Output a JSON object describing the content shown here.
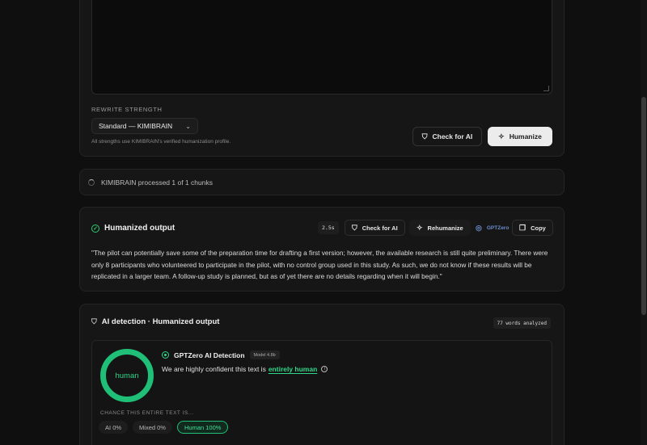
{
  "rewrite": {
    "label": "REWRITE STRENGTH",
    "selected": "Standard — KIMIBRAIN",
    "hint": "All strengths use KIMIBRAIN's verified humanization profile.",
    "check_label": "Check for AI",
    "humanize_label": "Humanize"
  },
  "status": {
    "text": "KIMIBRAIN processed 1 of 1 chunks"
  },
  "output": {
    "title": "Humanized output",
    "time": "2.5s",
    "check_label": "Check for AI",
    "rehumanize_label": "Rehumanize",
    "gptzero_label": "GPTZero",
    "copy_label": "Copy",
    "text": "\"The pilot can potentially save some of the preparation time for drafting a first version; however, the available research is still quite preliminary. There were only 8 participants who volunteered to participate in the pilot, with no control group used in this study. As such, we do not know if these results will be replicated in a larger team. A follow-up study is planned, but as of yet there are no details regarding when it will begin.\""
  },
  "detection": {
    "title": "AI detection · Humanized output",
    "words": "77 words analyzed",
    "ring_label": "human",
    "ring_color": "#1fbf78",
    "provider": "GPTZero AI Detection",
    "model": "Model 4.8b",
    "verdict_prefix": "We are highly confident this text is",
    "verdict_highlight": "entirely human",
    "chance_label": "CHANCE THIS ENTIRE TEXT IS...",
    "pills": [
      {
        "label": "AI",
        "value": "0%"
      },
      {
        "label": "Mixed",
        "value": "0%"
      },
      {
        "label": "Human",
        "value": "100%"
      }
    ]
  },
  "colors": {
    "accent_green": "#2fd88a",
    "background": "#0f0f0f"
  }
}
